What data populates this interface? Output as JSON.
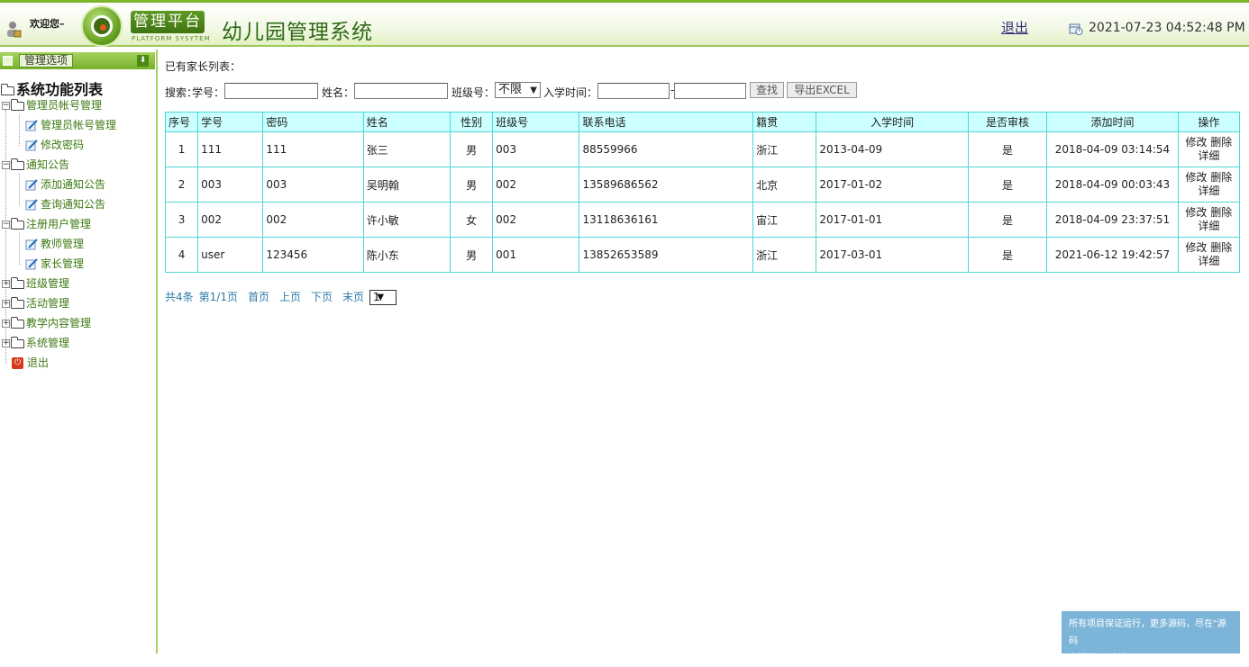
{
  "header": {
    "welcome": "欢迎您–",
    "logo_title": "管理平台",
    "logo_subtitle": "PLATFORM SYSYTEM",
    "site_title": "幼儿园管理系统",
    "logout": "退出",
    "datetime": "2021-07-23 04:52:48 PM",
    "accent": "#7fb52a"
  },
  "sidebar": {
    "panel_title": "管理选项",
    "root": "系统功能列表",
    "nodes": [
      {
        "label": "管理员帐号管理",
        "type": "folder",
        "expanded": true
      },
      {
        "label": "管理员帐号管理",
        "type": "leaf"
      },
      {
        "label": "修改密码",
        "type": "leaf"
      },
      {
        "label": "通知公告",
        "type": "folder",
        "expanded": true
      },
      {
        "label": "添加通知公告",
        "type": "leaf"
      },
      {
        "label": "查询通知公告",
        "type": "leaf"
      },
      {
        "label": "注册用户管理",
        "type": "folder",
        "expanded": true
      },
      {
        "label": "教师管理",
        "type": "leaf"
      },
      {
        "label": "家长管理",
        "type": "leaf"
      },
      {
        "label": "班级管理",
        "type": "folder",
        "expanded": false
      },
      {
        "label": "活动管理",
        "type": "folder",
        "expanded": false
      },
      {
        "label": "教学内容管理",
        "type": "folder",
        "expanded": false
      },
      {
        "label": "系统管理",
        "type": "folder",
        "expanded": false
      },
      {
        "label": "退出",
        "type": "exit"
      }
    ]
  },
  "main": {
    "caption": "已有家长列表：",
    "search": {
      "label": "搜索：",
      "student_id_label": "学号：",
      "name_label": "姓名：",
      "class_label": "班级号：",
      "class_value": "不限",
      "enroll_label": "入学时间：",
      "date_sep": "-",
      "find_button": "查找",
      "export_button": "导出EXCEL"
    },
    "table": {
      "headers": [
        "序号",
        "学号",
        "密码",
        "姓名",
        "性别",
        "班级号",
        "联系电话",
        "籍贯",
        "入学时间",
        "是否审核",
        "添加时间",
        "操作"
      ],
      "rows": [
        [
          "1",
          "111",
          "111",
          "张三",
          "男",
          "003",
          "88559966",
          "浙江",
          "2013-04-09",
          "是",
          "2018-04-09 03:14:54"
        ],
        [
          "2",
          "003",
          "003",
          "吴明翰",
          "男",
          "002",
          "13589686562",
          "北京",
          "2017-01-02",
          "是",
          "2018-04-09 00:03:43"
        ],
        [
          "3",
          "002",
          "002",
          "许小敏",
          "女",
          "002",
          "13118636161",
          "宙江",
          "2017-01-01",
          "是",
          "2018-04-09 23:37:51"
        ],
        [
          "4",
          "user",
          "123456",
          "陈小东",
          "男",
          "001",
          "13852653589",
          "浙江",
          "2017-03-01",
          "是",
          "2021-06-12 19:42:57"
        ]
      ],
      "ops": {
        "edit": "修改",
        "delete": "删除",
        "detail": "详细"
      }
    },
    "pager": {
      "total": "共4条",
      "page": "第1/1页",
      "first": "首页",
      "prev": "上页",
      "next": "下页",
      "last": "末页",
      "select_value": "1"
    }
  },
  "footer_note": {
    "line1": "所有项目保证运行，更多源码，尽在\"源码",
    "line2": "空间站\"，地址：www.shuyue.fun"
  }
}
